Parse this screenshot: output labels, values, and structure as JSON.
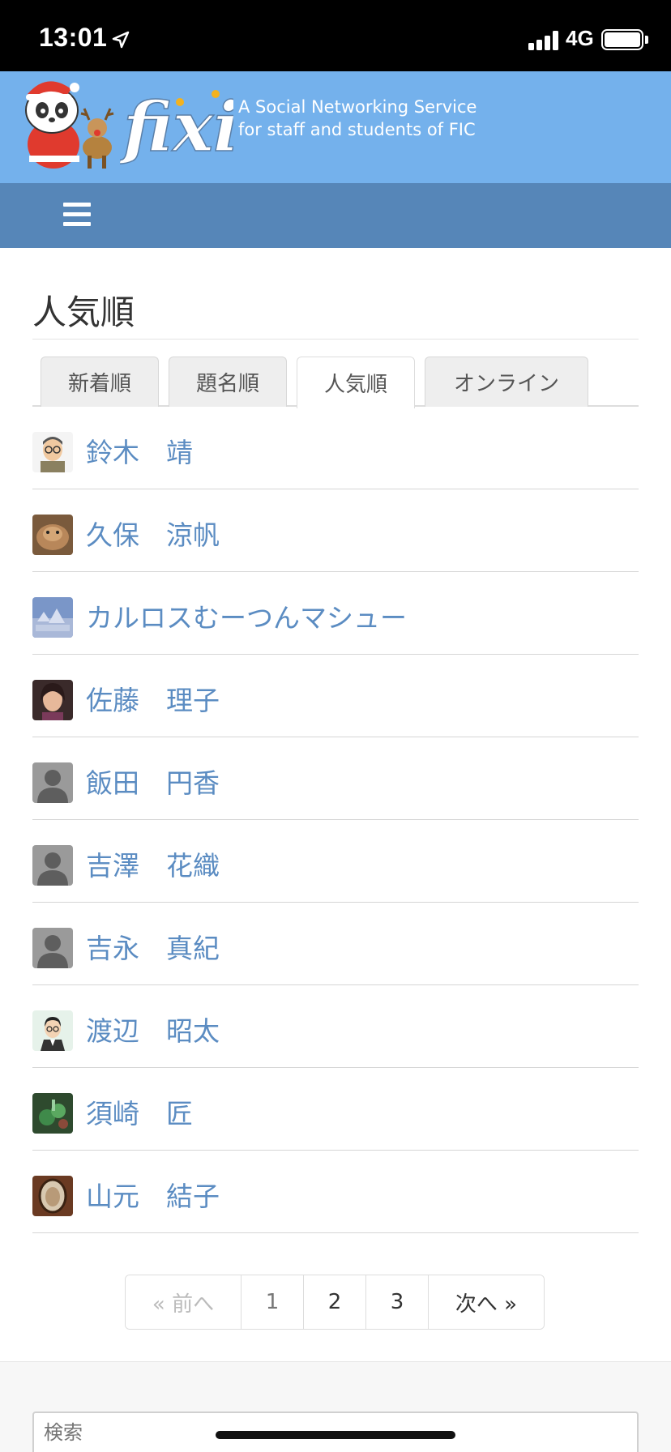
{
  "status_bar": {
    "time": "13:01",
    "network": "4G"
  },
  "banner": {
    "logo_text": "fixi",
    "tagline_line1": "A Social Networking Service",
    "tagline_line2": "for staff and students of FIC",
    "colors": {
      "background": "#74b1ec",
      "navbar": "#5686b8"
    }
  },
  "navbar": {
    "menu_icon": "hamburger-menu-icon"
  },
  "page": {
    "title": "人気順"
  },
  "tabs": [
    {
      "label": "新着順",
      "active": false
    },
    {
      "label": "題名順",
      "active": false
    },
    {
      "label": "人気順",
      "active": true
    },
    {
      "label": "オンライン",
      "active": false
    }
  ],
  "members": [
    {
      "name": "鈴木　靖",
      "avatar": "cartoon-man-glasses"
    },
    {
      "name": "久保　涼帆",
      "avatar": "brown-animal-photo"
    },
    {
      "name": "カルロスむーつんマシュー",
      "avatar": "blue-sky-photo"
    },
    {
      "name": "佐藤　理子",
      "avatar": "woman-photo"
    },
    {
      "name": "飯田　円香",
      "avatar": "default-silhouette"
    },
    {
      "name": "吉澤　花織",
      "avatar": "default-silhouette"
    },
    {
      "name": "吉永　真紀",
      "avatar": "default-silhouette"
    },
    {
      "name": "渡辺　昭太",
      "avatar": "cartoon-man-suit"
    },
    {
      "name": "須崎　匠",
      "avatar": "green-photo"
    },
    {
      "name": "山元　結子",
      "avatar": "brown-oval-photo"
    }
  ],
  "pagination": {
    "prev": "« 前へ",
    "pages": [
      "1",
      "2",
      "3"
    ],
    "next": "次へ »",
    "current": "2"
  },
  "search": {
    "placeholder": "検索"
  },
  "colors": {
    "link": "#5b8cc2",
    "divider": "#d6d6d6"
  }
}
